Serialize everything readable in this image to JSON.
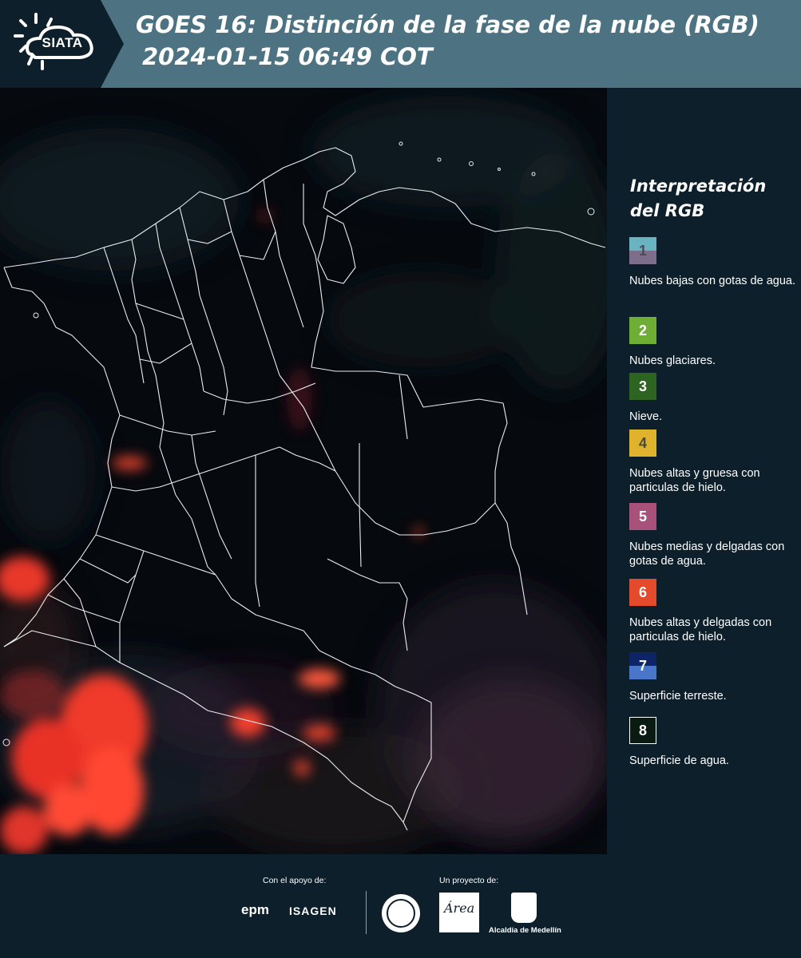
{
  "header": {
    "logo_text": "SIATA",
    "title_line1": "GOES 16: Distinción de la fase de la nube (RGB)",
    "title_line2": "2024-01-15 06:49 COT"
  },
  "legend": {
    "title_line1": "Interpretación",
    "title_line2": "del RGB",
    "items": [
      {
        "number": "1",
        "label": "Nubes bajas con gotas de agua.",
        "color_top": "#6ab4c2",
        "color_bottom": "#7d6e8c",
        "num_color": "#4b4b55"
      },
      {
        "number": "2",
        "label": "Nubes glaciares.",
        "color": "#6fae35",
        "num_color": "#ffffff"
      },
      {
        "number": "3",
        "label": "Nieve.",
        "color": "#2e6421",
        "num_color": "#ffffff"
      },
      {
        "number": "4",
        "label": "Nubes altas y gruesa con particulas de hielo.",
        "color": "#e0b32d",
        "num_color": "#4a4a3a"
      },
      {
        "number": "5",
        "label": "Nubes medias y delgadas con gotas de agua.",
        "color": "#a8517b",
        "num_color": "#ffffff"
      },
      {
        "number": "6",
        "label": "Nubes altas y delgadas con particulas de hielo.",
        "color": "#e34b2c",
        "num_color": "#ffffff"
      },
      {
        "number": "7",
        "label": "Superficie terreste.",
        "color_top": "#0d2466",
        "color_bottom": "#4a76c9",
        "num_color": "#ffffff"
      },
      {
        "number": "8",
        "label": "Superficie de agua.",
        "color": "#0a1b12",
        "num_color": "#ffffff",
        "border": "#ffffff"
      }
    ]
  },
  "footer": {
    "support_label": "Con el apoyo de:",
    "project_label": "Un proyecto de:",
    "sponsor_1": "epm",
    "sponsor_2": "ISAGEN",
    "partner_3_text": "Área",
    "partner_4": "Alcaldía de Medellín"
  }
}
